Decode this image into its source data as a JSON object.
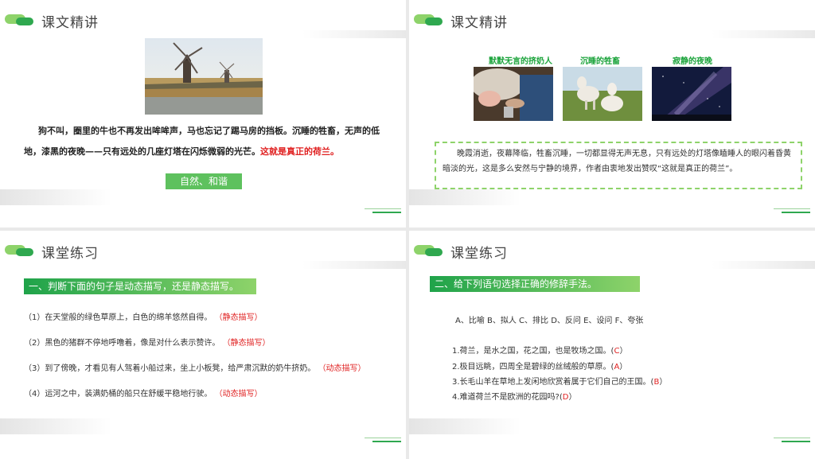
{
  "slides": [
    {
      "title": "课文精讲",
      "paragraph_main": "狗不叫，圈里的牛也不再发出哞哞声，马也忘记了踢马房的挡板。沉睡的牲畜，无声的低地，漆黑的夜晚——只有远处的几座灯塔在闪烁微弱的光芒。",
      "paragraph_red": "这就是真正的荷兰。",
      "tag": "自然、和谐"
    },
    {
      "title": "课文精讲",
      "captions": [
        "默默无言的挤奶人",
        "沉睡的牲畜",
        "寂静的夜晚"
      ],
      "paragraph": "晚霞消逝，夜幕降临，牲畜沉睡，一切都显得无声无息，只有远处的灯塔像瞌睡人的眼闪着昏黄暗淡的光，这是多么安然与宁静的境界，作者由衷地发出赞叹“这就是真正的荷兰”。"
    },
    {
      "title": "课堂练习",
      "banner": "一、判断下面的句子是动态描写，还是静态描写。",
      "questions": [
        {
          "text": "（1）在天堂般的绿色草原上，白色的绵羊悠然自得。",
          "answer": "（静态描写）"
        },
        {
          "text": "（2）黑色的猪群不停地呼噜着，像是对什么表示赞许。",
          "answer": "（静态描写）"
        },
        {
          "text": "（3）到了傍晚，才看见有人驾着小船过来，坐上小板凳，给严肃沉默的奶牛挤奶。",
          "answer": "（动态描写）"
        },
        {
          "text": "（4）运河之中，装满奶桶的船只在舒缓平稳地行驶。",
          "answer": "（动态描写）"
        }
      ]
    },
    {
      "title": "课堂练习",
      "banner": "二、给下列语句选择正确的修辞手法。",
      "options": "A、比喻 B、拟人 C、排比 D、反问 E、设问  F、夸张",
      "questions": [
        {
          "text": "1.荷兰，是水之国，花之国，也是牧场之国。(",
          "answer": "C",
          "end": "）"
        },
        {
          "text": "2.极目远眺，四周全是碧绿的丝绒般的草原。(",
          "answer": "A",
          "end": "）"
        },
        {
          "text": "3.长毛山羊在草地上发闲地欣赏着属于它们自己的王国。(",
          "answer": "B",
          "end": "）"
        },
        {
          "text": "4.难道荷兰不是欧洲的花园吗?(",
          "answer": "D",
          "end": "）"
        }
      ]
    }
  ],
  "colors": {
    "accent_green": "#2fa84f",
    "light_green": "#8ed36a",
    "answer_red": "#e02020"
  }
}
